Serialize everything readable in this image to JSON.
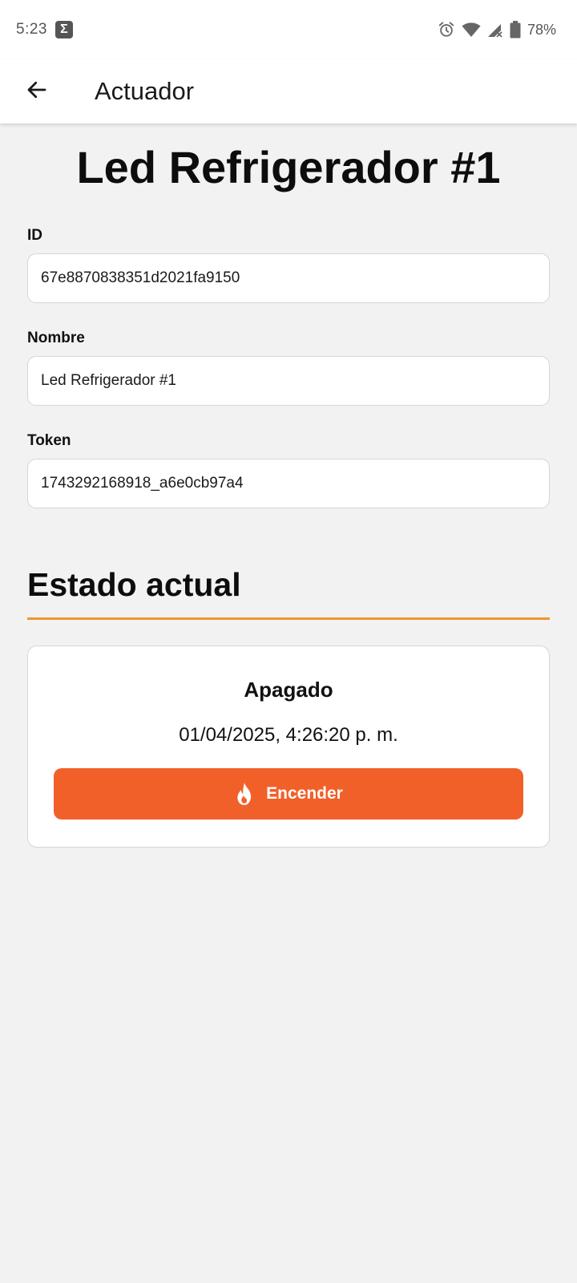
{
  "status_bar": {
    "time": "5:23",
    "notification_icon": "sigma-icon",
    "icons": [
      "alarm-icon",
      "wifi-icon",
      "signal-icon",
      "battery-icon"
    ],
    "battery": "78%"
  },
  "app_bar": {
    "back_icon": "arrow-back-icon",
    "title": "Actuador"
  },
  "device": {
    "title": "Led Refrigerador #1",
    "fields": [
      {
        "label": "ID",
        "value": "67e8870838351d2021fa9150"
      },
      {
        "label": "Nombre",
        "value": "Led Refrigerador #1"
      },
      {
        "label": "Token",
        "value": "1743292168918_a6e0cb97a4"
      }
    ]
  },
  "status_section": {
    "title": "Estado actual",
    "state": "Apagado",
    "timestamp": "01/04/2025, 4:26:20 p. m.",
    "action_label": "Encender",
    "action_icon": "flame-icon"
  },
  "colors": {
    "accent_line": "#f0962a",
    "action_button": "#f2602a",
    "background": "#f2f2f2"
  }
}
